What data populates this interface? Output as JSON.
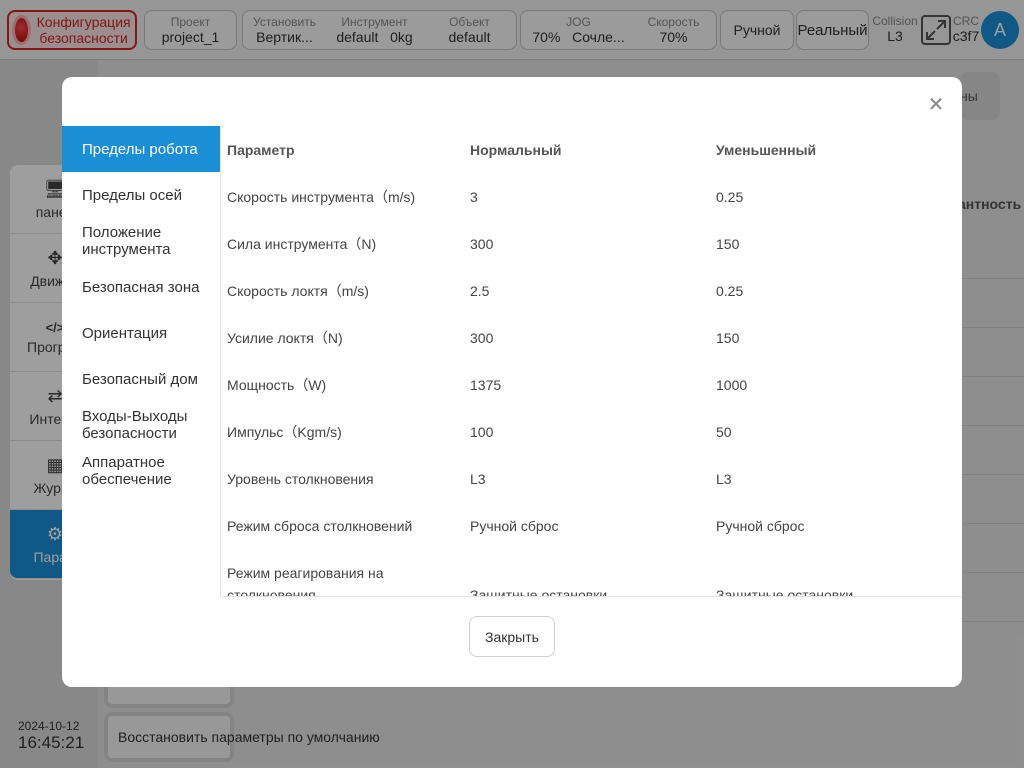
{
  "topbar": {
    "safety_config": "Конфигурация безопасности",
    "project": {
      "label": "Проект",
      "value": "project_1"
    },
    "install": {
      "label": "Установить",
      "value": "Вертик..."
    },
    "tool": {
      "label": "Инструмент",
      "value": "default",
      "weight": "0kg"
    },
    "object": {
      "label": "Объект",
      "value": "default"
    },
    "jog": {
      "label": "JOG",
      "value": "70%",
      "mode": "Сочле..."
    },
    "speed": {
      "label": "Скорость",
      "value": "70%"
    },
    "manual": "Ручной",
    "real": "Реальный",
    "collision": {
      "label": "Collision",
      "value": "L3"
    },
    "crc": {
      "label": "CRC",
      "value": "c3f7"
    },
    "avatar": "A"
  },
  "sidebar": {
    "items": [
      {
        "label": "панел",
        "icon": "monitor-icon"
      },
      {
        "label": "Движен",
        "icon": "move-icon"
      },
      {
        "label": "Програм",
        "icon": "code-icon"
      },
      {
        "label": "Интерф",
        "icon": "swap-icon"
      },
      {
        "label": "Журна",
        "icon": "calendar-icon"
      },
      {
        "label": "Парам",
        "icon": "gear-icon"
      }
    ],
    "date": "2024-10-12",
    "time": "16:45:21"
  },
  "background": {
    "right_card_text": "ны",
    "column_header": "антность",
    "restore_button": "Восстановить параметры по умолчанию"
  },
  "modal": {
    "tabs": [
      "Пределы робота",
      "Пределы осей",
      "Положение инструмента",
      "Безопасная зона",
      "Ориентация",
      "Безопасный дом",
      "Входы-Выходы безопасности",
      "Аппаратное обеспечение"
    ],
    "active_tab": 0,
    "table": {
      "headers": [
        "Параметр",
        "Нормальный",
        "Уменьшенный"
      ],
      "rows": [
        [
          "Скорость инструмента（m/s)",
          "3",
          "0.25"
        ],
        [
          "Сила инструмента（N)",
          "300",
          "150"
        ],
        [
          "Скорость локтя（m/s)",
          "2.5",
          "0.25"
        ],
        [
          "Усилие локтя（N)",
          "300",
          "150"
        ],
        [
          "Мощность（W)",
          "1375",
          "1000"
        ],
        [
          "Импульс（Kgm/s)",
          "100",
          "50"
        ],
        [
          "Уровень столкновения",
          "L3",
          "L3"
        ],
        [
          "Режим сброса столкновений",
          "Ручной сброс",
          "Ручной сброс"
        ],
        [
          "Режим реагирования на столкновения",
          "Защитные остановки",
          "Защитные остановки"
        ]
      ]
    },
    "close_button": "Закрыть"
  }
}
